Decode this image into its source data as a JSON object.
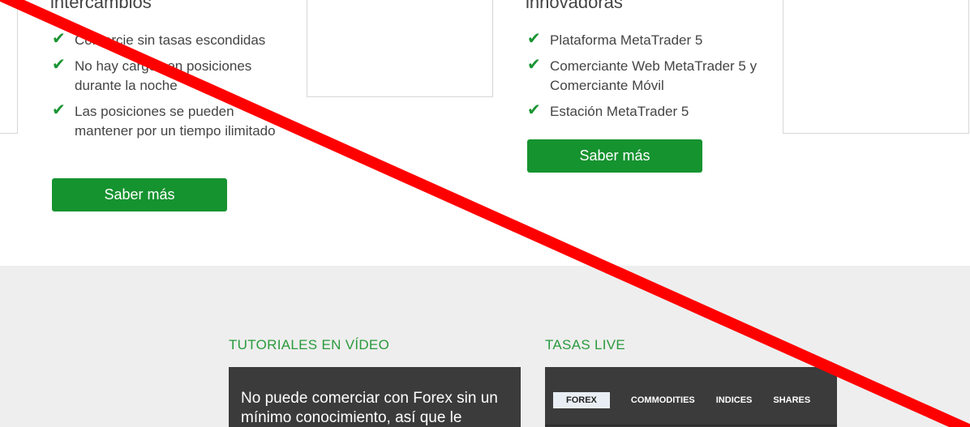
{
  "features_left": {
    "heading": "intercambios",
    "items": [
      "Comercie sin tasas escondidas",
      "No hay cargos en posiciones durante la noche",
      "Las posiciones se pueden mantener por un tiempo ilimitado"
    ],
    "button_label": "Saber más"
  },
  "features_right": {
    "heading": "innovadoras",
    "items": [
      "Plataforma MetaTrader 5",
      "Comerciante Web MetaTrader 5 y Comerciante Móvil",
      "Estación MetaTrader 5"
    ],
    "button_label": "Saber más"
  },
  "tutorials": {
    "title": "TUTORIALES EN VÍDEO",
    "text": "No puede comerciar con Forex sin un mínimo conocimiento, así que le"
  },
  "live_rates": {
    "title": "TASAS LIVE",
    "tabs": [
      "FOREX",
      "COMMODITIES",
      "INDICES",
      "SHARES"
    ],
    "active_tab": "FOREX"
  },
  "icons": {
    "check": "check-icon"
  },
  "colors": {
    "accent_green": "#15932f",
    "section_title_green": "#2a9a3c",
    "overlay_red": "#ff0000",
    "panel_dark": "#3b3b3b",
    "bottom_bg": "#eeeeee"
  }
}
